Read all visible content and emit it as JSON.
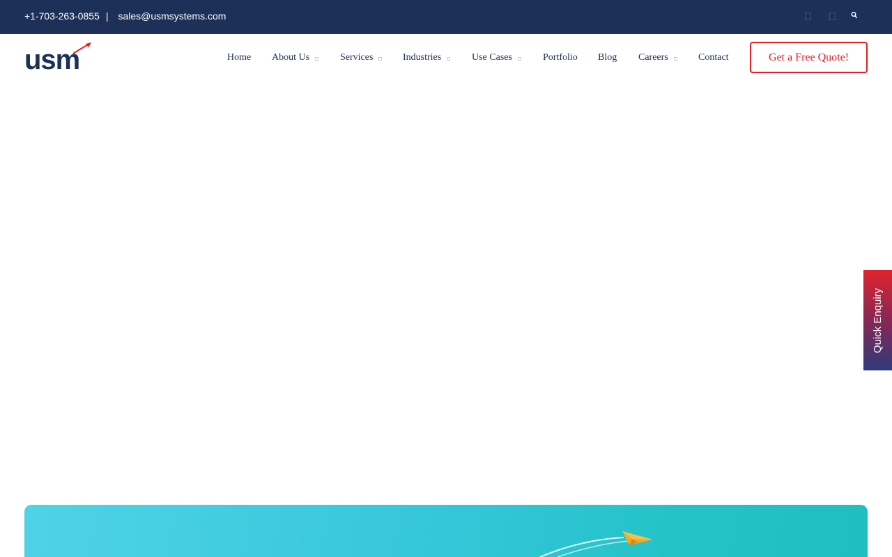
{
  "topbar": {
    "phone": "+1-703-263-0855",
    "separator": "|",
    "email": "sales@usmsystems.com",
    "social_icons": [
      "social-icon",
      "social-icon"
    ],
    "search_icon": "search-icon"
  },
  "brand": {
    "logo_text": "usm",
    "colors": {
      "navy": "#1d3058",
      "red": "#e31e24"
    }
  },
  "nav": {
    "items": [
      {
        "label": "Home",
        "has_dropdown": false
      },
      {
        "label": "About Us",
        "has_dropdown": true
      },
      {
        "label": "Services",
        "has_dropdown": true
      },
      {
        "label": "Industries",
        "has_dropdown": true
      },
      {
        "label": "Use Cases",
        "has_dropdown": true
      },
      {
        "label": "Portfolio",
        "has_dropdown": false
      },
      {
        "label": "Blog",
        "has_dropdown": false
      },
      {
        "label": "Careers",
        "has_dropdown": true
      },
      {
        "label": "Contact",
        "has_dropdown": false
      }
    ],
    "cta_label": "Get a Free Quote!"
  },
  "side_tab": {
    "label": "Quick Enquiry"
  },
  "banner": {
    "background": "#37c7dc",
    "accent": "#f5a623"
  }
}
